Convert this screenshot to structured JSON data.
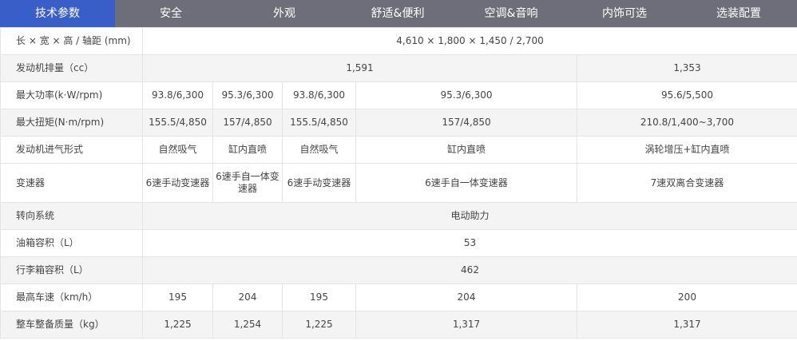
{
  "tabs": [
    {
      "label": "技术参数",
      "active": true
    },
    {
      "label": "安全"
    },
    {
      "label": "外观"
    },
    {
      "label": "舒适&便利"
    },
    {
      "label": "空调&音响"
    },
    {
      "label": "内饰可选"
    },
    {
      "label": "选装配置"
    }
  ],
  "colors": {
    "tab_bar": "#6e6e7a",
    "tab_active": "#3a5ec8",
    "row_alt": "#f4f4f4"
  },
  "spec": {
    "size": {
      "label": "长 × 宽 × 高 / 轴距 (mm)",
      "value": "4,610 × 1,800 × 1,450 / 2,700"
    },
    "displacement": {
      "label": "发动机排量（cc）",
      "v1": "1,591",
      "v2": "1,353"
    },
    "power": {
      "label": "最大功率(k·W/rpm)",
      "c1": "93.8/6,300",
      "c2": "95.3/6,300",
      "c3": "93.8/6,300",
      "c4": "95.3/6,300",
      "c5": "95.6/5,500"
    },
    "torque": {
      "label": "最大扭矩(N·m/rpm)",
      "c1": "155.5/4,850",
      "c2": "157/4,850",
      "c3": "155.5/4,850",
      "c4": "157/4,850",
      "c5": "210.8/1,400~3,700"
    },
    "intake": {
      "label": "发动机进气形式",
      "c1": "自然吸气",
      "c2": "缸内直喷",
      "c3": "自然吸气",
      "c4": "缸内直喷",
      "c5": "涡轮增压+缸内直喷"
    },
    "transmission": {
      "label": "变速器",
      "c1": "6速手动变速器",
      "c2": "6速手自一体变速器",
      "c3": "6速手动变速器",
      "c4": "6速手自一体变速器",
      "c5": "7速双离合变速器"
    },
    "steering": {
      "label": "转向系统",
      "value": "电动助力"
    },
    "fuel_tank": {
      "label": "油箱容积（L）",
      "value": "53"
    },
    "trunk": {
      "label": "行李箱容积（L）",
      "value": "462"
    },
    "top_speed": {
      "label": "最高车速（km/h）",
      "c1": "195",
      "c2": "204",
      "c3": "195",
      "c4": "204",
      "c5": "200"
    },
    "curb_weight": {
      "label": "整车整备质量（kg）",
      "c1": "1,225",
      "c2": "1,254",
      "c3": "1,225",
      "c4": "1,317",
      "c5": "1,317"
    }
  }
}
